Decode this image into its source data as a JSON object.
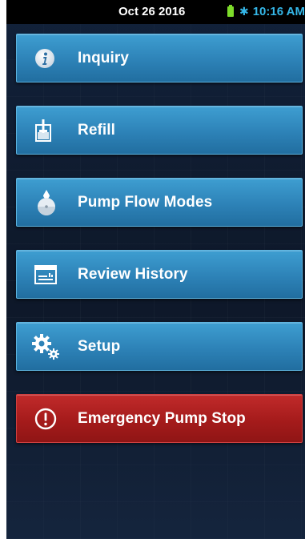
{
  "status_bar": {
    "date": "Oct 26 2016",
    "time": "10:16 AM",
    "battery_icon": "battery-charging-icon",
    "bluetooth_icon": "bluetooth-icon"
  },
  "menu": {
    "items": [
      {
        "label": "Inquiry",
        "icon": "info-icon"
      },
      {
        "label": "Refill",
        "icon": "refill-icon"
      },
      {
        "label": "Pump Flow Modes",
        "icon": "pump-flow-icon"
      },
      {
        "label": "Review History",
        "icon": "history-icon"
      },
      {
        "label": "Setup",
        "icon": "gears-icon"
      },
      {
        "label": "Emergency Pump Stop",
        "icon": "alert-icon"
      }
    ]
  },
  "colors": {
    "button_blue": "#2d82b7",
    "button_red": "#a51b1b",
    "status_blue": "#35b7e8",
    "battery_green": "#7ddc2a",
    "background": "#0f1a2c"
  }
}
